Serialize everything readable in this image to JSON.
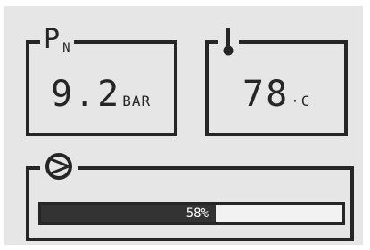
{
  "pressure": {
    "label": "P",
    "subscript": "N",
    "value": "9.2",
    "unit": "BAR",
    "icon": "pressure-icon"
  },
  "temperature": {
    "value": "78",
    "unit": "·C",
    "icon": "thermometer-icon"
  },
  "pump": {
    "icon": "pump-icon",
    "progress_fraction": 0.58,
    "progress_label": "58%"
  },
  "colors": {
    "background": "#e6e6e6",
    "foreground": "#262626",
    "fill": "#333333"
  }
}
